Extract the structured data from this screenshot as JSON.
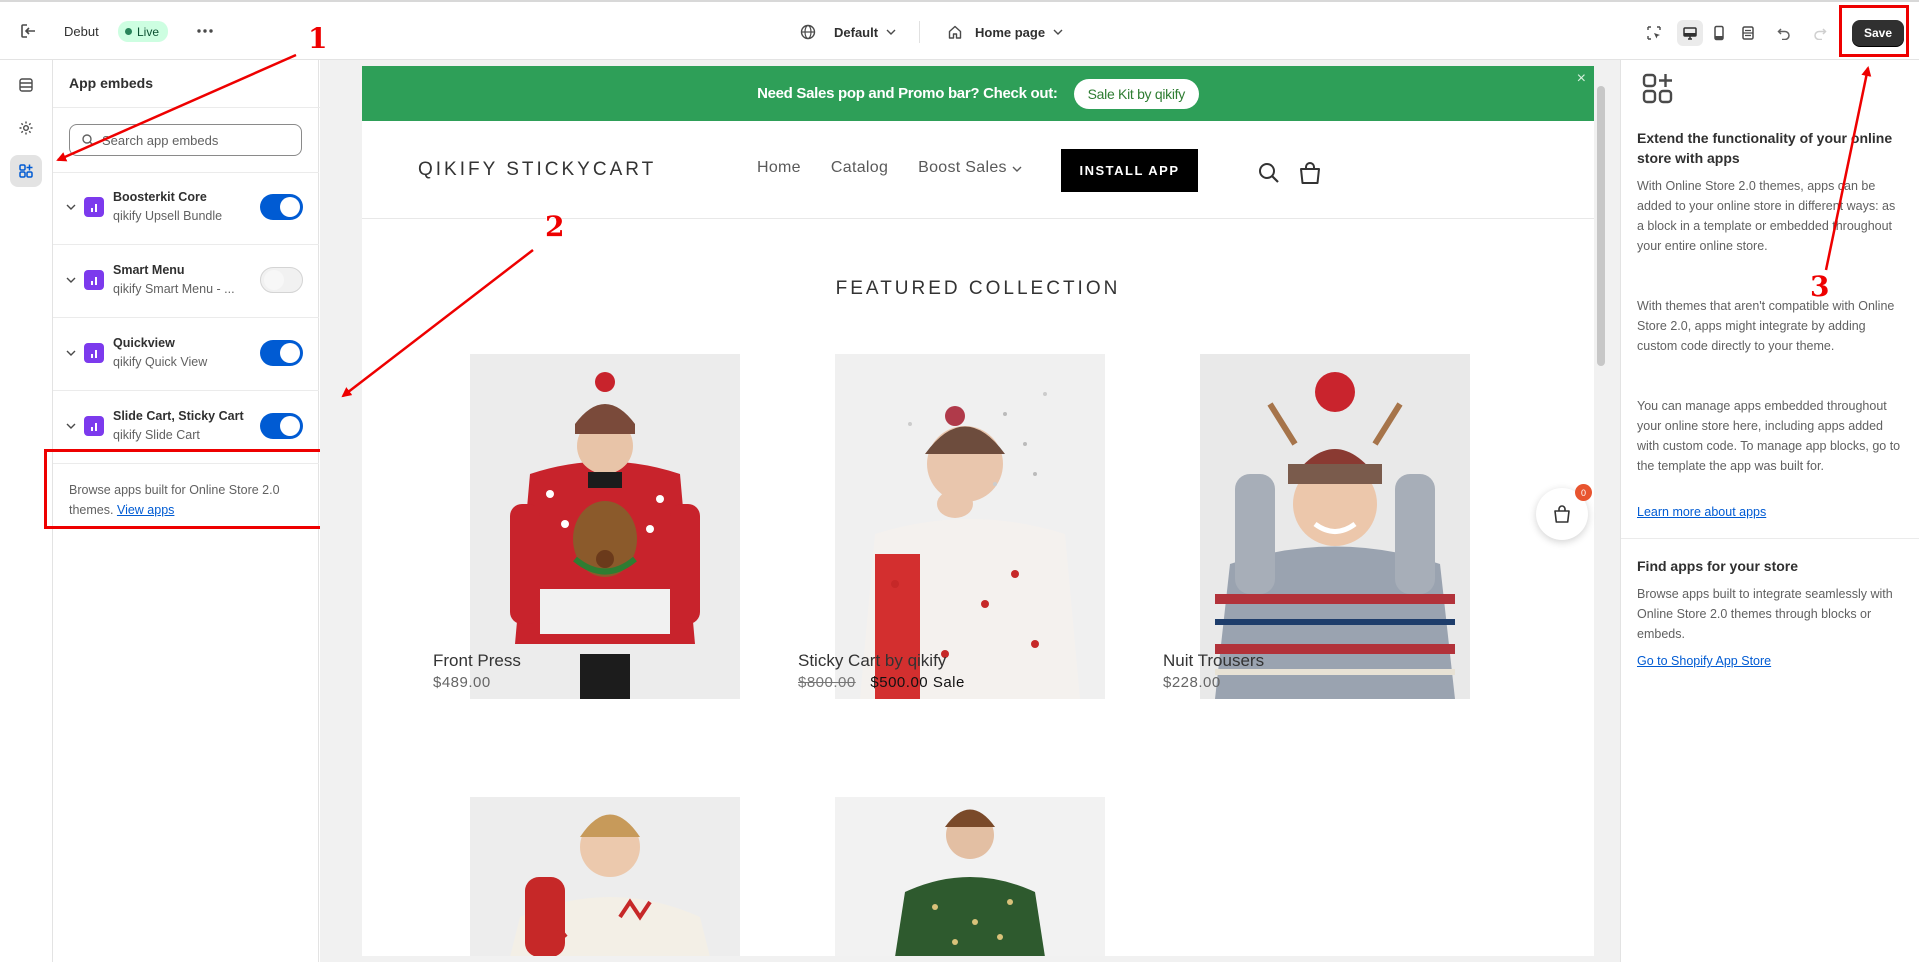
{
  "topbar": {
    "exit_icon": "exit-icon",
    "theme_name": "Debut",
    "live_label": "Live",
    "theme_select": "Default",
    "page_select": "Home page",
    "save_label": "Save"
  },
  "rail": {
    "items": [
      "sections-icon",
      "settings-icon",
      "app-embeds-icon"
    ]
  },
  "panel": {
    "title": "App embeds",
    "search_placeholder": "Search app embeds",
    "embeds": [
      {
        "name": "Boosterkit Core",
        "sub": "qikify Upsell Bundle",
        "enabled": true
      },
      {
        "name": "Smart Menu",
        "sub": "qikify Smart Menu - ...",
        "enabled": false
      },
      {
        "name": "Quickview",
        "sub": "qikify Quick View",
        "enabled": true
      },
      {
        "name": "Slide Cart, Sticky Cart",
        "sub": "qikify Slide Cart",
        "enabled": true
      }
    ],
    "browse_text": "Browse apps built for Online Store 2.0 themes.",
    "browse_link": "View apps"
  },
  "preview": {
    "promo_text": "Need Sales pop and Promo bar? Check out:",
    "promo_button": "Sale Kit by qikify",
    "promo_close": "×",
    "store_name": "QIKIFY STICKYCART",
    "nav": [
      "Home",
      "Catalog",
      "Boost Sales"
    ],
    "install_button": "INSTALL APP",
    "featured_title": "FEATURED COLLECTION",
    "cart_count": "0",
    "products": [
      {
        "name": "Front Press",
        "price": "$489.00",
        "old_price": "",
        "sale_label": ""
      },
      {
        "name": "Sticky Cart by qikify",
        "price": "$500.00",
        "old_price": "$800.00",
        "sale_label": "Sale"
      },
      {
        "name": "Nuit Trousers",
        "price": "$228.00",
        "old_price": "",
        "sale_label": ""
      }
    ]
  },
  "info": {
    "title": "Extend the functionality of your online store with apps",
    "p1": "With Online Store 2.0 themes, apps can be added to your online store in different ways: as a block in a template or embedded throughout your entire online store.",
    "p2": "With themes that aren't compatible with Online Store 2.0, apps might integrate by adding custom code directly to your theme.",
    "p3": "You can manage apps embedded throughout your online store here, including apps added with custom code. To manage app blocks, go to the template the app was built for.",
    "link1": "Learn more about apps",
    "h2": "Find apps for your store",
    "p4": "Browse apps built to integrate seamlessly with Online Store 2.0 themes through blocks or embeds.",
    "link2": "Go to Shopify App Store"
  },
  "annotations": {
    "n1": "1",
    "n2": "2",
    "n3": "3"
  },
  "colors": {
    "accent": "#005bd3",
    "promo_green": "#2e9f58",
    "annotation_red": "#ee0000",
    "app_logo": "#7c3aed"
  }
}
